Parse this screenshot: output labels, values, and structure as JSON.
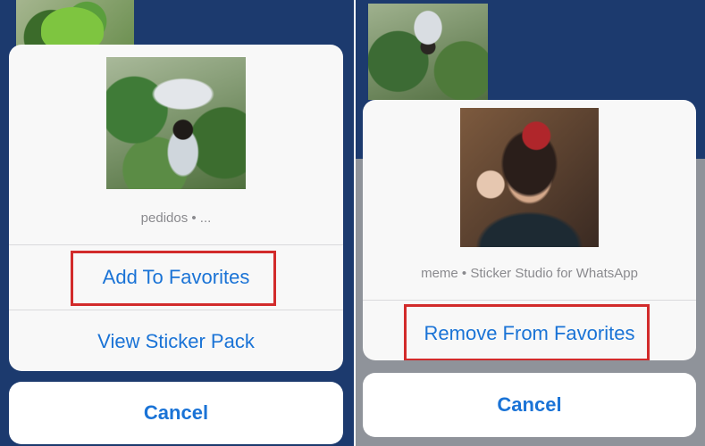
{
  "left": {
    "sticker_meta": "pedidos • ...",
    "actions": {
      "add_to_favorites": "Add To Favorites",
      "view_sticker_pack": "View Sticker Pack"
    },
    "cancel_label": "Cancel"
  },
  "right": {
    "sticker_meta": "meme • Sticker Studio for WhatsApp",
    "actions": {
      "remove_from_favorites": "Remove From Favorites"
    },
    "cancel_label": "Cancel"
  },
  "colors": {
    "accent": "#1a73d6",
    "highlight": "#d22b2b",
    "background": "#1c3a6e"
  },
  "icons": {
    "left_sticker": "sticker-rain-image",
    "right_sticker": "sticker-meme-image"
  }
}
